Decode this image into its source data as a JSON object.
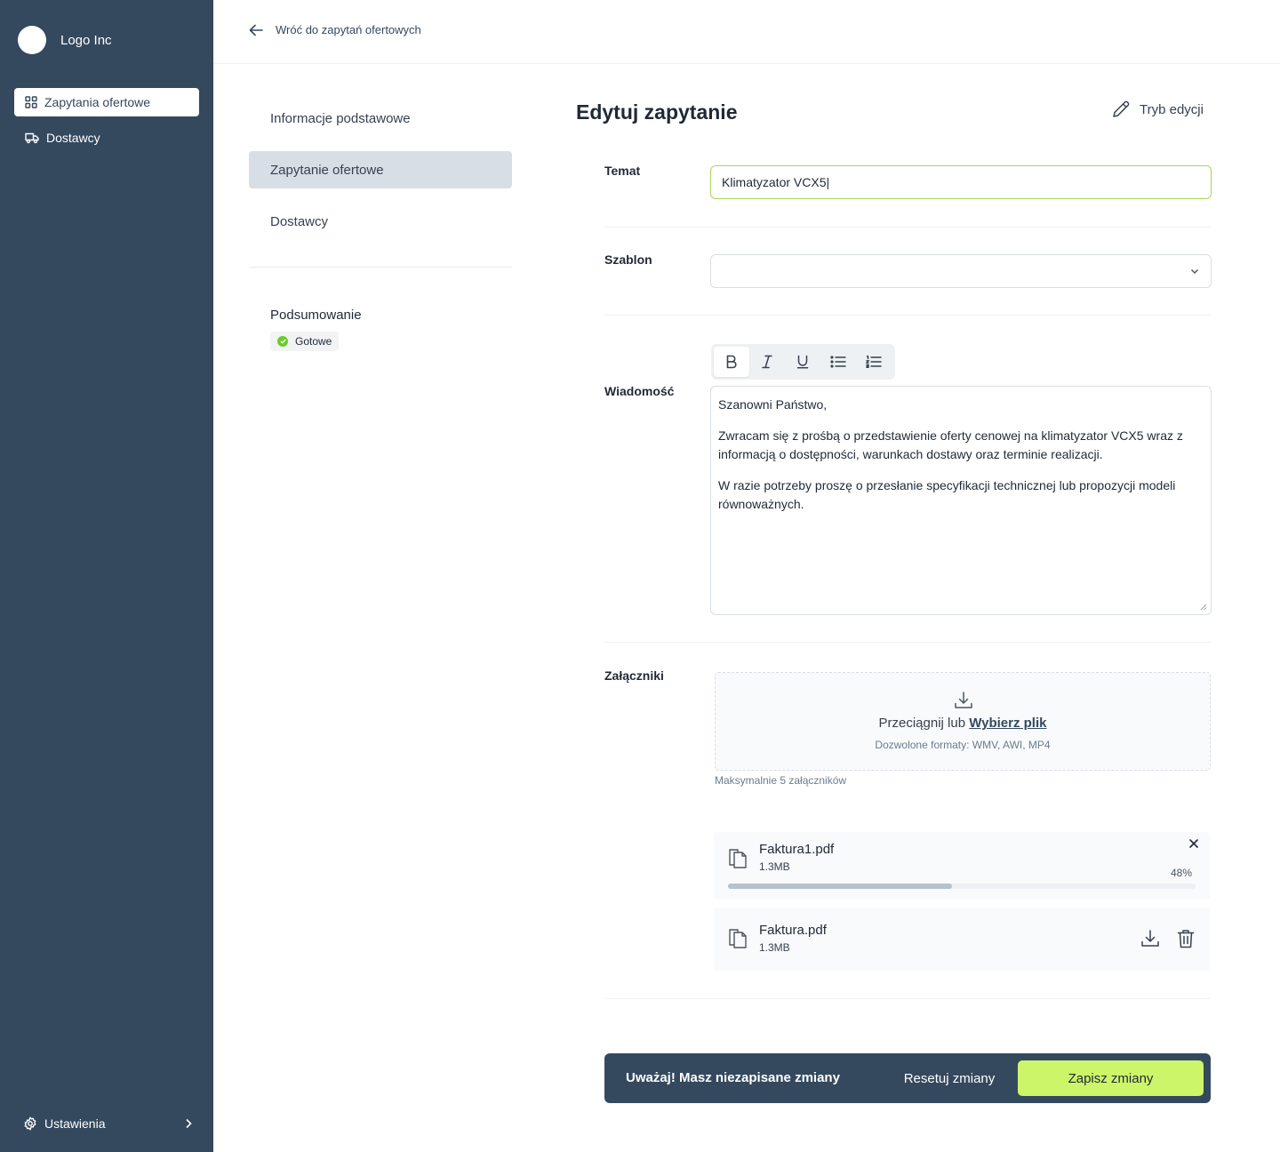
{
  "app": {
    "logo_text": "Logo Inc"
  },
  "sidebar": {
    "items": [
      {
        "label": "Zapytania ofertowe",
        "icon": "grid-icon",
        "active": true
      },
      {
        "label": "Dostawcy",
        "icon": "truck-icon",
        "active": false
      }
    ],
    "settings_label": "Ustawienia"
  },
  "header": {
    "back_label": "Wróć do zapytań ofertowych"
  },
  "steps": {
    "items": [
      {
        "label": "Informacje podstawowe",
        "active": false
      },
      {
        "label": "Zapytanie ofertowe",
        "active": true
      },
      {
        "label": "Dostawcy",
        "active": false
      }
    ],
    "summary_title": "Podsumowanie",
    "summary_status": "Gotowe"
  },
  "form": {
    "title": "Edytuj zapytanie",
    "edit_mode_label": "Tryb edycji",
    "subject": {
      "label": "Temat",
      "value": "Klimatyzator VCX5|"
    },
    "template": {
      "label": "Szablon",
      "value": ""
    },
    "message": {
      "label": "Wiadomość",
      "toolbar": [
        "bold",
        "italic",
        "underline",
        "bullet-list",
        "numbered-list"
      ],
      "paragraphs": [
        "Szanowni Państwo,",
        "Zwracam się z prośbą o przedstawienie oferty cenowej na klimatyzator VCX5 wraz z informacją o dostępności, warunkach dostawy oraz terminie realizacji.",
        "W razie potrzeby proszę o przesłanie specyfikacji technicznej lub propozycji modeli równoważnych."
      ]
    },
    "attachments": {
      "label": "Załączniki",
      "drop_text": "Przeciągnij lub",
      "drop_link": "Wybierz plik",
      "formats": "Dozwolone formaty: WMV, AWI, MP4",
      "max_note": "Maksymalnie 5 załączników",
      "files": [
        {
          "name": "Faktura1.pdf",
          "size": "1.3MB",
          "progress": 48,
          "progress_label": "48%",
          "uploading": true
        },
        {
          "name": "Faktura.pdf",
          "size": "1.3MB",
          "uploading": false
        }
      ]
    }
  },
  "savebar": {
    "warning": "Uważaj! Masz niezapisane zmiany",
    "reset_label": "Resetuj zmiany",
    "save_label": "Zapisz zmiany"
  },
  "colors": {
    "sidebar_bg": "#34495e",
    "accent": "#cdf56a",
    "input_focus_border": "#a8d65a",
    "status_ok": "#6bcb2a"
  }
}
